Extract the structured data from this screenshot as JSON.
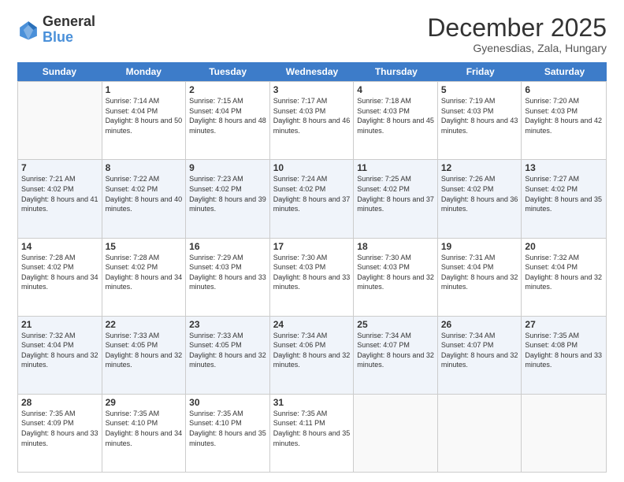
{
  "logo": {
    "line1": "General",
    "line2": "Blue"
  },
  "title": "December 2025",
  "location": "Gyenesdias, Zala, Hungary",
  "days_of_week": [
    "Sunday",
    "Monday",
    "Tuesday",
    "Wednesday",
    "Thursday",
    "Friday",
    "Saturday"
  ],
  "weeks": [
    [
      {
        "day": "",
        "empty": true
      },
      {
        "day": "1",
        "rise": "7:14 AM",
        "set": "4:04 PM",
        "daylight": "8 hours and 50 minutes."
      },
      {
        "day": "2",
        "rise": "7:15 AM",
        "set": "4:04 PM",
        "daylight": "8 hours and 48 minutes."
      },
      {
        "day": "3",
        "rise": "7:17 AM",
        "set": "4:03 PM",
        "daylight": "8 hours and 46 minutes."
      },
      {
        "day": "4",
        "rise": "7:18 AM",
        "set": "4:03 PM",
        "daylight": "8 hours and 45 minutes."
      },
      {
        "day": "5",
        "rise": "7:19 AM",
        "set": "4:03 PM",
        "daylight": "8 hours and 43 minutes."
      },
      {
        "day": "6",
        "rise": "7:20 AM",
        "set": "4:03 PM",
        "daylight": "8 hours and 42 minutes."
      }
    ],
    [
      {
        "day": "7",
        "rise": "7:21 AM",
        "set": "4:02 PM",
        "daylight": "8 hours and 41 minutes."
      },
      {
        "day": "8",
        "rise": "7:22 AM",
        "set": "4:02 PM",
        "daylight": "8 hours and 40 minutes."
      },
      {
        "day": "9",
        "rise": "7:23 AM",
        "set": "4:02 PM",
        "daylight": "8 hours and 39 minutes."
      },
      {
        "day": "10",
        "rise": "7:24 AM",
        "set": "4:02 PM",
        "daylight": "8 hours and 37 minutes."
      },
      {
        "day": "11",
        "rise": "7:25 AM",
        "set": "4:02 PM",
        "daylight": "8 hours and 37 minutes."
      },
      {
        "day": "12",
        "rise": "7:26 AM",
        "set": "4:02 PM",
        "daylight": "8 hours and 36 minutes."
      },
      {
        "day": "13",
        "rise": "7:27 AM",
        "set": "4:02 PM",
        "daylight": "8 hours and 35 minutes."
      }
    ],
    [
      {
        "day": "14",
        "rise": "7:28 AM",
        "set": "4:02 PM",
        "daylight": "8 hours and 34 minutes."
      },
      {
        "day": "15",
        "rise": "7:28 AM",
        "set": "4:02 PM",
        "daylight": "8 hours and 34 minutes."
      },
      {
        "day": "16",
        "rise": "7:29 AM",
        "set": "4:03 PM",
        "daylight": "8 hours and 33 minutes."
      },
      {
        "day": "17",
        "rise": "7:30 AM",
        "set": "4:03 PM",
        "daylight": "8 hours and 33 minutes."
      },
      {
        "day": "18",
        "rise": "7:30 AM",
        "set": "4:03 PM",
        "daylight": "8 hours and 32 minutes."
      },
      {
        "day": "19",
        "rise": "7:31 AM",
        "set": "4:04 PM",
        "daylight": "8 hours and 32 minutes."
      },
      {
        "day": "20",
        "rise": "7:32 AM",
        "set": "4:04 PM",
        "daylight": "8 hours and 32 minutes."
      }
    ],
    [
      {
        "day": "21",
        "rise": "7:32 AM",
        "set": "4:04 PM",
        "daylight": "8 hours and 32 minutes."
      },
      {
        "day": "22",
        "rise": "7:33 AM",
        "set": "4:05 PM",
        "daylight": "8 hours and 32 minutes."
      },
      {
        "day": "23",
        "rise": "7:33 AM",
        "set": "4:05 PM",
        "daylight": "8 hours and 32 minutes."
      },
      {
        "day": "24",
        "rise": "7:34 AM",
        "set": "4:06 PM",
        "daylight": "8 hours and 32 minutes."
      },
      {
        "day": "25",
        "rise": "7:34 AM",
        "set": "4:07 PM",
        "daylight": "8 hours and 32 minutes."
      },
      {
        "day": "26",
        "rise": "7:34 AM",
        "set": "4:07 PM",
        "daylight": "8 hours and 32 minutes."
      },
      {
        "day": "27",
        "rise": "7:35 AM",
        "set": "4:08 PM",
        "daylight": "8 hours and 33 minutes."
      }
    ],
    [
      {
        "day": "28",
        "rise": "7:35 AM",
        "set": "4:09 PM",
        "daylight": "8 hours and 33 minutes."
      },
      {
        "day": "29",
        "rise": "7:35 AM",
        "set": "4:10 PM",
        "daylight": "8 hours and 34 minutes."
      },
      {
        "day": "30",
        "rise": "7:35 AM",
        "set": "4:10 PM",
        "daylight": "8 hours and 35 minutes."
      },
      {
        "day": "31",
        "rise": "7:35 AM",
        "set": "4:11 PM",
        "daylight": "8 hours and 35 minutes."
      },
      {
        "day": "",
        "empty": true
      },
      {
        "day": "",
        "empty": true
      },
      {
        "day": "",
        "empty": true
      }
    ]
  ]
}
